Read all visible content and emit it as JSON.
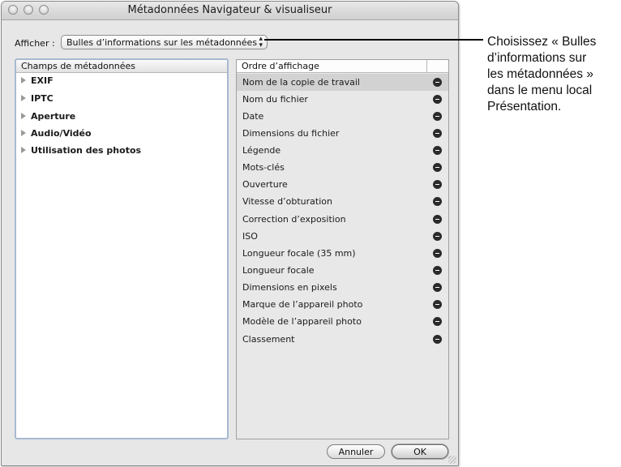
{
  "window": {
    "title": "Métadonnées Navigateur & visualiseur"
  },
  "afficher": {
    "label": "Afficher :",
    "selected_value": "Bulles d’informations sur les métadonnées",
    "arrows": "⬍"
  },
  "left_panel": {
    "header": "Champs de métadonnées",
    "items": [
      {
        "label": "EXIF"
      },
      {
        "label": "IPTC"
      },
      {
        "label": "Aperture"
      },
      {
        "label": "Audio/Vidéo"
      },
      {
        "label": "Utilisation des photos"
      }
    ]
  },
  "right_panel": {
    "header": "Ordre d’affichage",
    "items": [
      {
        "label": "Nom de la copie de travail"
      },
      {
        "label": "Nom du fichier"
      },
      {
        "label": "Date"
      },
      {
        "label": "Dimensions du fichier"
      },
      {
        "label": "Légende"
      },
      {
        "label": "Mots-clés"
      },
      {
        "label": "Ouverture"
      },
      {
        "label": "Vitesse d’obturation"
      },
      {
        "label": "Correction d’exposition"
      },
      {
        "label": "ISO"
      },
      {
        "label": "Longueur focale (35 mm)"
      },
      {
        "label": "Longueur focale"
      },
      {
        "label": "Dimensions en pixels"
      },
      {
        "label": "Marque de l’appareil photo"
      },
      {
        "label": "Modèle de l’appareil photo"
      },
      {
        "label": "Classement"
      }
    ]
  },
  "buttons": {
    "cancel": "Annuler",
    "ok": "OK"
  },
  "callout": {
    "lines": [
      "Choisissez « Bulles",
      "d’informations sur",
      "les métadonnées »",
      "dans le menu local",
      "Présentation."
    ]
  }
}
